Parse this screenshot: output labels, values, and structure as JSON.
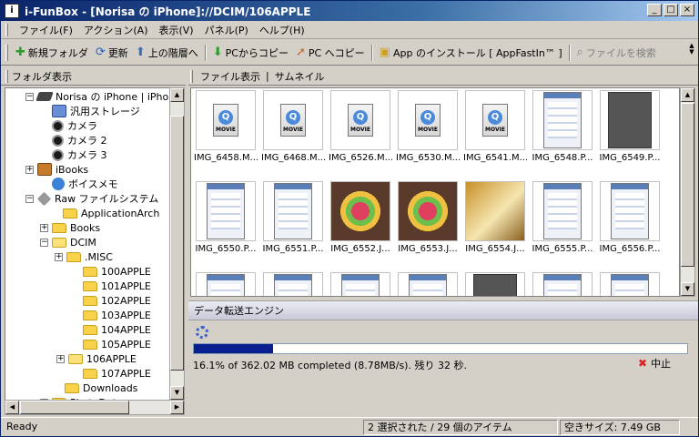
{
  "window": {
    "app_icon": "i",
    "title": "i-FunBox - [Norisa の iPhone]://DCIM/106APPLE",
    "minimize": "_",
    "maximize": "□",
    "close": "×"
  },
  "menu": [
    {
      "label": "ファイル(F)"
    },
    {
      "label": "アクション(A)"
    },
    {
      "label": "表示(V)"
    },
    {
      "label": "パネル(P)"
    },
    {
      "label": "ヘルプ(H)"
    }
  ],
  "toolbar": {
    "new_folder": "新規フォルダ",
    "refresh": "更新",
    "parent": "上の階層へ",
    "copy_from_pc": "PCからコピー",
    "copy_to_pc": "PC へコピー",
    "install_app": "App のインストール [ AppFastIn™ ]",
    "search_files": "ファイルを検索",
    "icons": {
      "new_folder": "plus-icon",
      "refresh": "refresh-icon",
      "parent": "arrow-up-icon",
      "copy_from_pc": "arrow-down-icon",
      "copy_to_pc": "arrow-up-right-icon",
      "install_app": "app-icon",
      "search": "magnifier-icon"
    }
  },
  "folder_panel": {
    "title": "フォルダ表示",
    "tree": [
      {
        "label": "Norisa の iPhone | iPho",
        "icon": "phone-icon",
        "expander": "−"
      },
      {
        "label": "汎用ストレージ",
        "icon": "storage-icon",
        "expander": ""
      },
      {
        "label": "カメラ",
        "icon": "camera-icon",
        "expander": ""
      },
      {
        "label": "カメラ 2",
        "icon": "camera-icon",
        "expander": ""
      },
      {
        "label": "カメラ 3",
        "icon": "camera-icon",
        "expander": ""
      },
      {
        "label": "iBooks",
        "icon": "book-icon",
        "expander": "+"
      },
      {
        "label": "ボイスメモ",
        "icon": "voice-memo-icon",
        "expander": ""
      },
      {
        "label": "Raw ファイルシステム",
        "icon": "raw-filesystem-icon",
        "expander": "−"
      },
      {
        "label": "ApplicationArch",
        "icon": "folder-icon",
        "expander": ""
      },
      {
        "label": "Books",
        "icon": "folder-icon",
        "expander": "+"
      },
      {
        "label": "DCIM",
        "icon": "folder-open-icon",
        "expander": "−"
      },
      {
        "label": ".MISC",
        "icon": "folder-icon",
        "expander": "+"
      },
      {
        "label": "100APPLE",
        "icon": "folder-icon",
        "expander": ""
      },
      {
        "label": "101APPLE",
        "icon": "folder-icon",
        "expander": ""
      },
      {
        "label": "102APPLE",
        "icon": "folder-icon",
        "expander": ""
      },
      {
        "label": "103APPLE",
        "icon": "folder-icon",
        "expander": ""
      },
      {
        "label": "104APPLE",
        "icon": "folder-icon",
        "expander": ""
      },
      {
        "label": "105APPLE",
        "icon": "folder-icon",
        "expander": ""
      },
      {
        "label": "106APPLE",
        "icon": "folder-open-icon",
        "expander": "+"
      },
      {
        "label": "107APPLE",
        "icon": "folder-icon",
        "expander": ""
      },
      {
        "label": "Downloads",
        "icon": "folder-icon",
        "expander": ""
      },
      {
        "label": "PhotoData",
        "icon": "folder-icon",
        "expander": "+"
      }
    ]
  },
  "file_panel": {
    "title": "ファイル表示",
    "separator": "|",
    "view_mode": "サムネイル",
    "files": [
      {
        "name": "IMG_6458.M...",
        "kind": "movie"
      },
      {
        "name": "IMG_6468.M...",
        "kind": "movie"
      },
      {
        "name": "IMG_6526.M...",
        "kind": "movie"
      },
      {
        "name": "IMG_6530.M...",
        "kind": "movie"
      },
      {
        "name": "IMG_6541.M...",
        "kind": "movie"
      },
      {
        "name": "IMG_6548.P...",
        "kind": "screenshot"
      },
      {
        "name": "IMG_6549.P...",
        "kind": "screenshot-dark"
      },
      {
        "name": "IMG_6550.P...",
        "kind": "screenshot"
      },
      {
        "name": "IMG_6551.P...",
        "kind": "screenshot"
      },
      {
        "name": "IMG_6552.J...",
        "kind": "photo-candy"
      },
      {
        "name": "IMG_6553.J...",
        "kind": "photo-candy"
      },
      {
        "name": "IMG_6554.J...",
        "kind": "photo-gold"
      },
      {
        "name": "IMG_6555.P...",
        "kind": "screenshot"
      },
      {
        "name": "IMG_6556.P...",
        "kind": "screenshot"
      },
      {
        "name": "",
        "kind": "screenshot"
      },
      {
        "name": "",
        "kind": "screenshot"
      },
      {
        "name": "",
        "kind": "screenshot"
      },
      {
        "name": "",
        "kind": "screenshot"
      },
      {
        "name": "",
        "kind": "screenshot-dark"
      },
      {
        "name": "",
        "kind": "screenshot"
      },
      {
        "name": "",
        "kind": "screenshot"
      }
    ],
    "movie_label": "MOVIE",
    "movie_glyph": "Q"
  },
  "transfer": {
    "title": "データ転送エンジン",
    "progress_fraction": 0.161,
    "status": "16.1% of 362.02 MB completed (8.78MB/s). 残り 32 秒.",
    "stop_label": "中止",
    "stop_glyph": "✖"
  },
  "statusbar": {
    "state": "Ready",
    "selection": "2 選択された / 29 個のアイテム",
    "free_space": "空きサイズ: 7.49 GB"
  }
}
